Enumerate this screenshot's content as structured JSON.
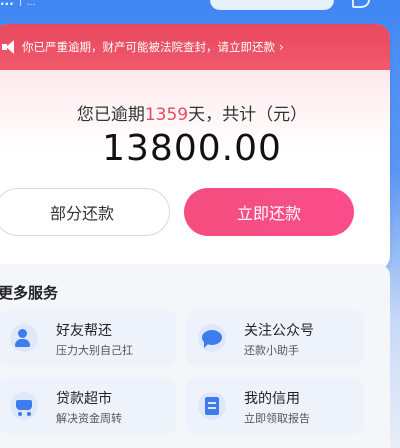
{
  "header": {
    "brand": "...",
    "slogan": "...",
    "search_pill": "",
    "message_icon": "chat-icon"
  },
  "notice": {
    "icon": "speaker-icon",
    "text": "你已严重逾期，财产可能被法院查封，请立即还款",
    "arrow": "›"
  },
  "debt": {
    "prefix": "您已逾期",
    "days": "1359",
    "suffix": "天，共计（元）",
    "amount": "13800.00"
  },
  "actions": {
    "partial": "部分还款",
    "repay_now": "立即还款"
  },
  "services": {
    "title": "更多服务",
    "items": [
      {
        "icon": "person-icon",
        "label": "好友帮还",
        "sub": "压力大别自己扛"
      },
      {
        "icon": "chat-bubble-icon",
        "label": "关注公众号",
        "sub": "还款小助手"
      },
      {
        "icon": "cart-icon",
        "label": "贷款超市",
        "sub": "解决资金周转"
      },
      {
        "icon": "document-icon",
        "label": "我的信用",
        "sub": "立即领取报告"
      }
    ]
  },
  "colors": {
    "accent_blue": "#3f86f4",
    "alert_red": "#e8485e",
    "repay_pink": "#f34e7f"
  }
}
